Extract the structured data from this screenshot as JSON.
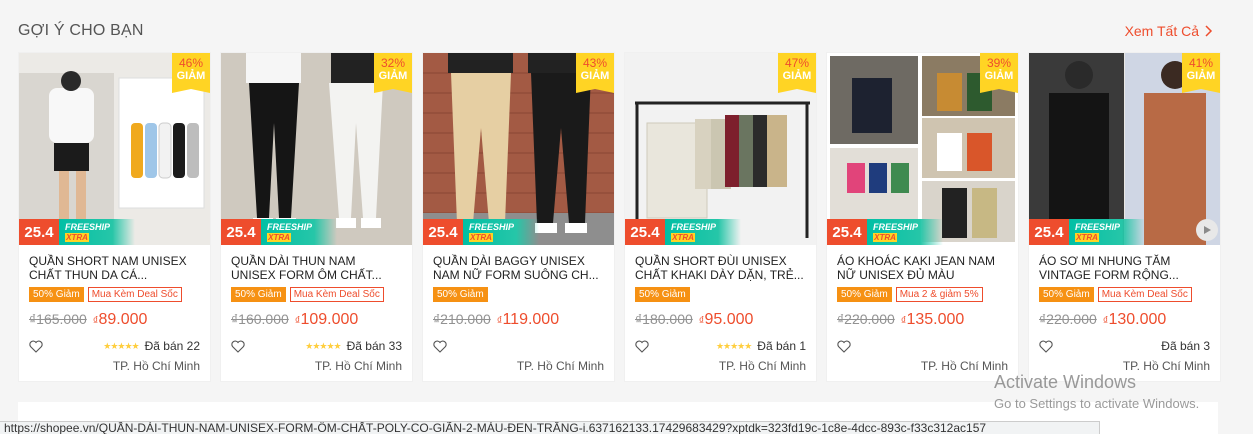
{
  "section": {
    "title": "GỢI Ý CHO BẠN",
    "see_all": "Xem Tất Cả"
  },
  "promo": {
    "tag": "25.4",
    "freeship": "FREESHIP",
    "xtra": "XTRA",
    "discount_label": "GIẢM"
  },
  "products": [
    {
      "discount": "46%",
      "name": "QUẦN SHORT NAM UNISEX CHẤT THUN DA CÁ...",
      "badge": "50% Giảm",
      "deal": "Mua Kèm Deal Sốc",
      "old_price": "₫165.000",
      "price_cur": "₫",
      "price": "89.000",
      "rating_stars": 5,
      "stars": "★★★★★",
      "sold": "Đã bán 22",
      "location": "TP. Hồ Chí Minh"
    },
    {
      "discount": "32%",
      "name": "QUẦN DÀI THUN NAM UNISEX FORM ÔM CHẤT...",
      "badge": "50% Giảm",
      "deal": "Mua Kèm Deal Sốc",
      "old_price": "₫160.000",
      "price_cur": "₫",
      "price": "109.000",
      "rating_stars": 4.5,
      "stars": "★★★★★",
      "sold": "Đã bán 33",
      "location": "TP. Hồ Chí Minh"
    },
    {
      "discount": "43%",
      "name": "QUẦN DÀI BAGGY UNISEX NAM NỮ FORM SUÔNG CH...",
      "badge": "50% Giảm",
      "deal": "",
      "old_price": "₫210.000",
      "price_cur": "₫",
      "price": "119.000",
      "rating_stars": 0,
      "stars": "",
      "sold": "",
      "location": "TP. Hồ Chí Minh"
    },
    {
      "discount": "47%",
      "name": "QUẦN SHORT ĐÙI UNISEX CHẤT KHAKI DÀY DẶN, TRẺ...",
      "badge": "50% Giảm",
      "deal": "",
      "old_price": "₫180.000",
      "price_cur": "₫",
      "price": "95.000",
      "rating_stars": 5,
      "stars": "★★★★★",
      "sold": "Đã bán 1",
      "location": "TP. Hồ Chí Minh"
    },
    {
      "discount": "39%",
      "name": "ÁO KHOÁC KAKI JEAN NAM NỮ UNISEX ĐỦ MÀU",
      "badge": "50% Giảm",
      "deal": "Mua 2 & giảm 5%",
      "old_price": "₫220.000",
      "price_cur": "₫",
      "price": "135.000",
      "rating_stars": 0,
      "stars": "",
      "sold": "",
      "location": "TP. Hồ Chí Minh"
    },
    {
      "discount": "41%",
      "name": "ÁO SƠ MI NHUNG TĂM VINTAGE FORM RỘNG...",
      "badge": "50% Giảm",
      "deal": "Mua Kèm Deal Sốc",
      "old_price": "₫220.000",
      "price_cur": "₫",
      "price": "130.000",
      "rating_stars": 0,
      "stars": "",
      "sold": "Đã bán 3",
      "location": "TP. Hồ Chí Minh"
    }
  ],
  "status_bar": {
    "url": "https://shopee.vn/QUẦN-DÀI-THUN-NAM-UNISEX-FORM-ÔM-CHẤT-POLY-CO-GIÃN-2-MÀU-ĐEN-TRẮNG-i.637162133.17429683429?xptdk=323fd19c-1c8e-4dcc-893c-f33c312ac157"
  },
  "watermark": {
    "line1": "Activate Windows",
    "line2": "Go to Settings to activate Windows."
  },
  "colors": {
    "accent": "#ee4d2d",
    "discount_bg": "#ffd424",
    "badge_orange": "#f69113",
    "freeship_teal": "#00bfa5"
  }
}
